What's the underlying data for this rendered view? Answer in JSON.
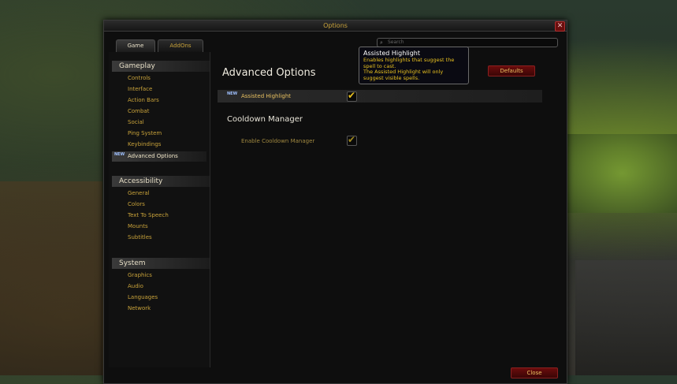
{
  "window": {
    "title": "Options"
  },
  "tabs": [
    {
      "label": "Game"
    },
    {
      "label": "AddOns"
    }
  ],
  "search": {
    "placeholder": "Search"
  },
  "sidebar": {
    "gameplay": {
      "header": "Gameplay",
      "items": [
        "Controls",
        "Interface",
        "Action Bars",
        "Combat",
        "Social",
        "Ping System",
        "Keybindings",
        "Advanced Options"
      ],
      "selected": "Advanced Options",
      "new_badge": "NEW"
    },
    "accessibility": {
      "header": "Accessibility",
      "items": [
        "General",
        "Colors",
        "Text To Speech",
        "Mounts",
        "Subtitles"
      ]
    },
    "system": {
      "header": "System",
      "items": [
        "Graphics",
        "Audio",
        "Languages",
        "Network"
      ]
    }
  },
  "main": {
    "title": "Advanced Options",
    "defaults_label": "Defaults",
    "options": [
      {
        "label": "Assisted Highlight",
        "badge": "NEW",
        "checked": true
      },
      {
        "label": "Enable Cooldown Manager",
        "checked": true
      }
    ],
    "section": "Cooldown Manager"
  },
  "tooltip": {
    "title": "Assisted Highlight",
    "line1": "Enables highlights that suggest the",
    "line2": "spell to cast.",
    "line3": "The Assisted Highlight will only",
    "line4": "suggest visible spells."
  },
  "footer": {
    "close_label": "Close"
  },
  "colors": {
    "accent": "#c8a23a",
    "button_red": "#6a0c0c",
    "tooltip_text": "#e8c020"
  },
  "icons": {
    "close": "close-icon",
    "search": "search-icon",
    "check": "check-icon"
  }
}
